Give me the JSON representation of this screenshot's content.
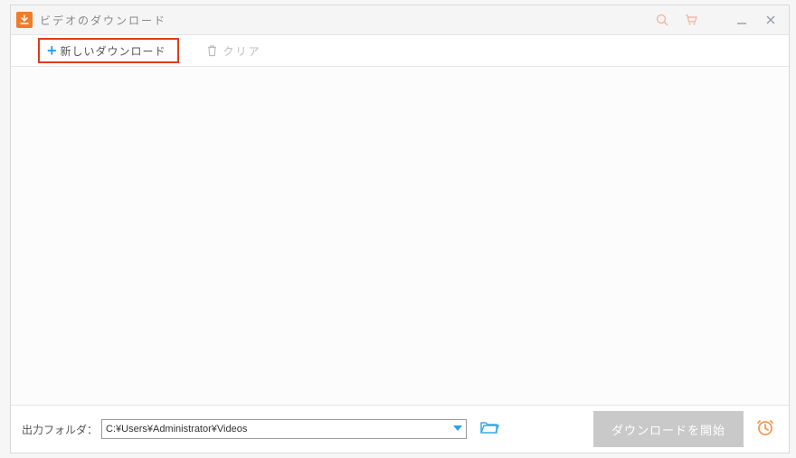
{
  "window": {
    "title": "ビデオのダウンロード"
  },
  "toolbar": {
    "new_download_label": "新しいダウンロード",
    "clear_label": "クリア"
  },
  "footer": {
    "output_label": "出力フォルダ：",
    "output_path": "C:¥Users¥Administrator¥Videos",
    "start_label": "ダウンロードを開始"
  }
}
